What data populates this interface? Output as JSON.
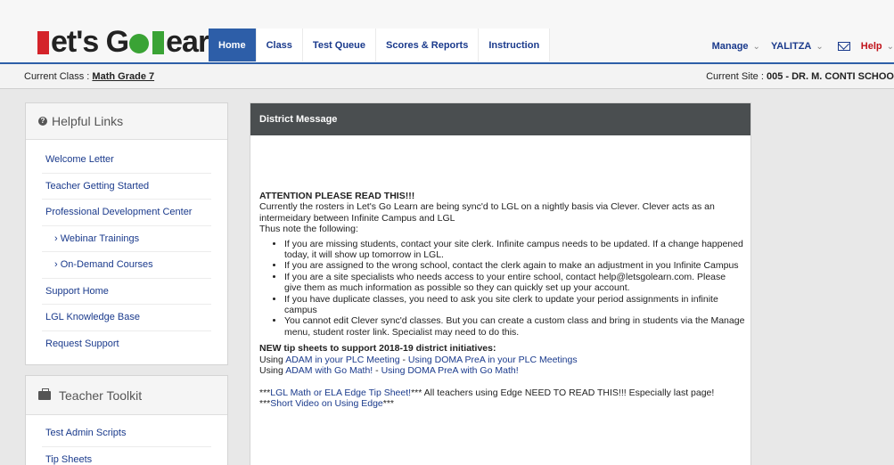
{
  "logo": {
    "p1": "L",
    "p2": "et",
    "p3": "s G",
    "p4": "l",
    "p5": "earn",
    "full": "Let's Go Learn"
  },
  "tabs": [
    {
      "label": "Home",
      "active": true
    },
    {
      "label": "Class"
    },
    {
      "label": "Test Queue"
    },
    {
      "label": "Scores & Reports"
    },
    {
      "label": "Instruction"
    }
  ],
  "rightnav": {
    "manage": "Manage",
    "user": "YALITZA",
    "help": "Help",
    "chevron": "⌄"
  },
  "classbar": {
    "class_prefix": "Current Class : ",
    "class_name": "Math Grade 7",
    "site_prefix": "Current Site : ",
    "site_name": "005 - DR. M. CONTI SCHOO"
  },
  "helpful_links": {
    "title": "Helpful Links",
    "icon": "question-circle-icon",
    "items": [
      "Welcome Letter",
      "Teacher Getting Started",
      "Professional Development Center",
      "› Webinar Trainings",
      "› On-Demand Courses",
      "Support Home",
      "LGL Knowledge Base",
      "Request Support"
    ]
  },
  "teacher_toolkit": {
    "title": "Teacher Toolkit",
    "icon": "briefcase-icon",
    "items": [
      "Test Admin Scripts",
      "Tip Sheets"
    ]
  },
  "message": {
    "title": "District Message",
    "attention": "ATTENTION PLEASE READ THIS!!!",
    "intro": "Currently the rosters in Let's Go Learn are being sync'd to LGL on a nightly basis via Clever.  Clever acts as an intermeidary between Infinite Campus and LGL",
    "note": "Thus note the following:",
    "bullets": [
      "If you are missing students, contact your site clerk.  Infinite campus needs to be updated.  If a change happened today, it will show up tomorrow in LGL.",
      "If you are assigned to the wrong school, contact the clerk again to make an adjustment in you Infinite Campus",
      "If you are a site specialists who needs access to your entire school, contact help@letsgolearn.com.  Please give them as much information as possible so they can quickly set up your account.",
      "If you have duplicate classes, you need to ask you site clerk to update your period assignments in infinite campus",
      "You cannot edit Clever sync'd classes.  But you can create a custom class and bring in students via the Manage menu, student roster link.  Specialist may need to do this."
    ],
    "new_tip": "NEW tip sheets to support 2018-19 district initiatives:",
    "line1_prefix": "Using ",
    "line1_link1": "ADAM in your PLC Meeting",
    "line1_sep": " - ",
    "line1_link2": "Using DOMA PreA in your PLC Meetings",
    "line2_prefix": "Using ",
    "line2_link1": "ADAM with Go Math!",
    "line2_sep": " - ",
    "line2_link2": "Using DOMA PreA with Go Math!",
    "edge_pre": "***",
    "edge_link": "LGL Math or ELA Edge Tip Sheet!",
    "edge_post": "***  All teachers using Edge NEED TO READ THIS!!!  Especially last page!",
    "video_pre": "***",
    "video_link": "Short Video on Using Edge",
    "video_post": "***"
  }
}
